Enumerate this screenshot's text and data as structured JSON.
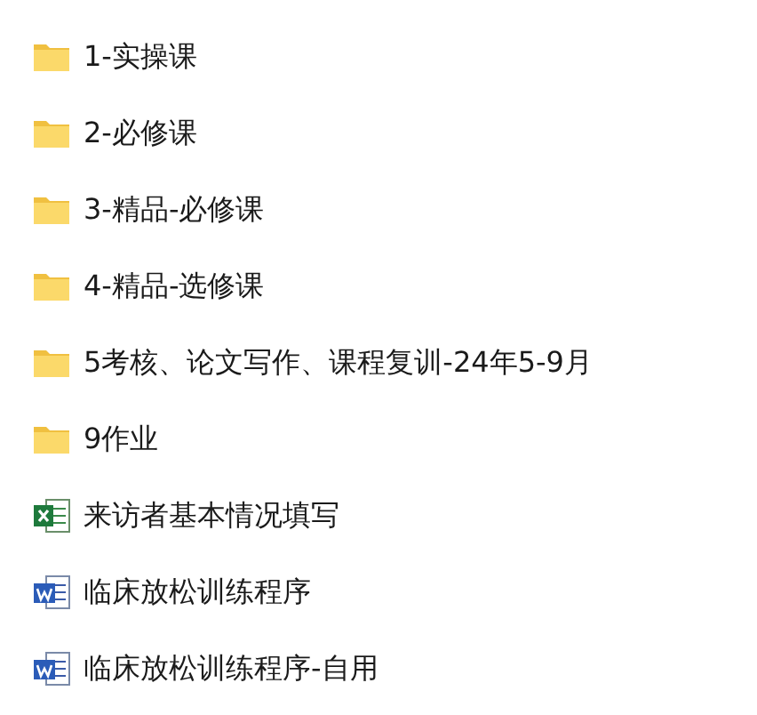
{
  "items": [
    {
      "kind": "folder",
      "name": "1-实操课"
    },
    {
      "kind": "folder",
      "name": "2-必修课"
    },
    {
      "kind": "folder",
      "name": "3-精品-必修课"
    },
    {
      "kind": "folder",
      "name": "4-精品-选修课"
    },
    {
      "kind": "folder",
      "name": "5考核、论文写作、课程复训-24年5-9月"
    },
    {
      "kind": "folder",
      "name": "9作业"
    },
    {
      "kind": "spreadsheet",
      "name": "来访者基本情况填写"
    },
    {
      "kind": "document",
      "name": "临床放松训练程序"
    },
    {
      "kind": "document",
      "name": "临床放松训练程序-自用"
    }
  ]
}
